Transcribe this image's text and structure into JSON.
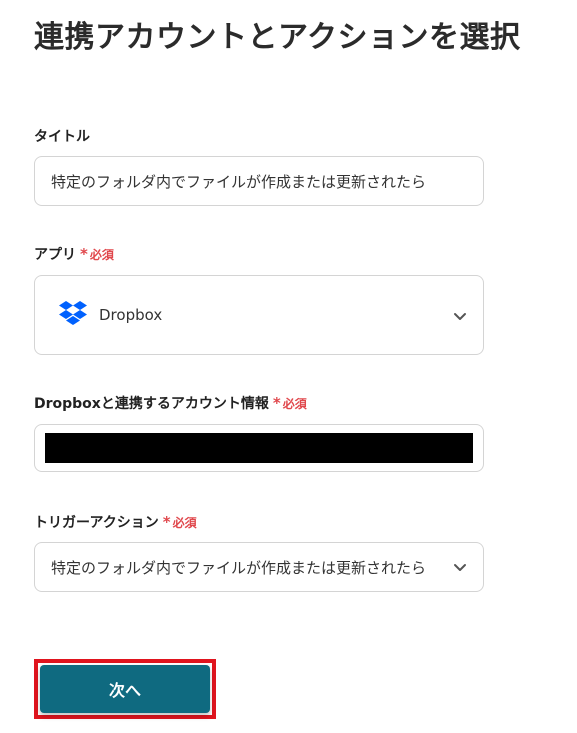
{
  "page": {
    "title": "連携アカウントとアクションを選択"
  },
  "required_label": {
    "star": "*",
    "text": "必須"
  },
  "fields": {
    "title": {
      "label": "タイトル",
      "value": "特定のフォルダ内でファイルが作成または更新されたら"
    },
    "app": {
      "label": "アプリ",
      "selected": "Dropbox",
      "icon": "dropbox-logo",
      "icon_color": "#0061fe"
    },
    "account": {
      "label": "Dropboxと連携するアカウント情報",
      "value_redacted": true
    },
    "trigger": {
      "label": "トリガーアクション",
      "selected": "特定のフォルダ内でファイルが作成または更新されたら"
    }
  },
  "actions": {
    "next_label": "次へ"
  },
  "colors": {
    "accent": "#0f6a80",
    "required": "#e0474c",
    "highlight": "#e0141e"
  }
}
